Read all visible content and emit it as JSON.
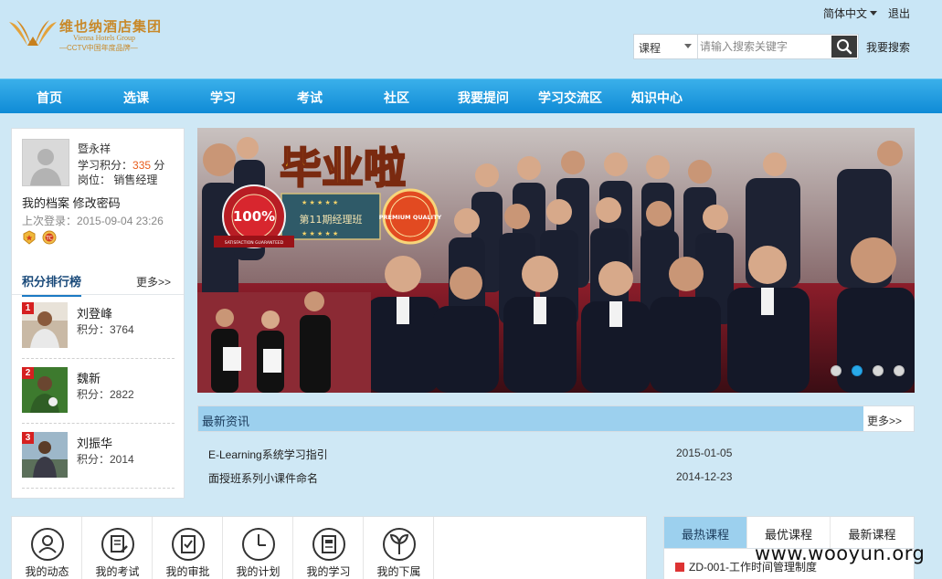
{
  "header": {
    "logo_cn": "维也纳酒店集团",
    "logo_en": "Vienna Hotels Group",
    "logo_sub": "—CCTV中国年度品牌—",
    "language": "简体中文",
    "logout": "退出",
    "search": {
      "category": "课程",
      "placeholder": "请输入搜索关键字",
      "advanced": "我要搜索"
    }
  },
  "nav": [
    "首页",
    "选课",
    "学习",
    "考试",
    "社区",
    "我要提问",
    "学习交流区",
    "知识中心"
  ],
  "profile": {
    "name": "暨永祥",
    "points_label": "学习积分：",
    "points": "335",
    "points_unit": "分",
    "position_label": "岗位：",
    "position": "销售经理",
    "my_profile": "我的档案",
    "change_password": "修改密码",
    "last_login_label": "上次登录：",
    "last_login": "2015-09-04 23:26"
  },
  "ranking": {
    "title": "积分排行榜",
    "more": "更多>>",
    "items": [
      {
        "rank": "1",
        "name": "刘登峰",
        "score": "积分：3764"
      },
      {
        "rank": "2",
        "name": "魏新",
        "score": "积分：2822"
      },
      {
        "rank": "3",
        "name": "刘振华",
        "score": "积分：2014"
      }
    ]
  },
  "banner": {
    "headline": "毕业啦",
    "class_label": "第11期经理班",
    "seal_text": "100%",
    "seal_ribbon": "SATISFACTION GUARANTEED",
    "quality_text": "PREMIUM QUALITY",
    "slides": 4,
    "active_slide": 2
  },
  "news": {
    "title": "最新资讯",
    "more": "更多>>",
    "items": [
      {
        "title": "E-Learning系统学习指引",
        "date": "2015-01-05"
      },
      {
        "title": "面授班系列小课件命名",
        "date": "2014-12-23"
      }
    ]
  },
  "quick_links": [
    {
      "label": "我的动态",
      "icon": "user-icon"
    },
    {
      "label": "我的考试",
      "icon": "exam-icon"
    },
    {
      "label": "我的审批",
      "icon": "approval-icon"
    },
    {
      "label": "我的计划",
      "icon": "clock-icon"
    },
    {
      "label": "我的学习",
      "icon": "study-icon"
    },
    {
      "label": "我的下属",
      "icon": "plant-icon"
    }
  ],
  "courses": {
    "tabs": [
      "最热课程",
      "最优课程",
      "最新课程"
    ],
    "active_tab": 0,
    "items": [
      {
        "title": "ZD-001-工作时间管理制度"
      }
    ]
  },
  "watermark": "www.wooyun.org",
  "colors": {
    "page_bg": "#cfe8f5",
    "nav": "#1596dd",
    "accent_orange": "#e85c1b",
    "tab_active": "#9cd0ee"
  }
}
